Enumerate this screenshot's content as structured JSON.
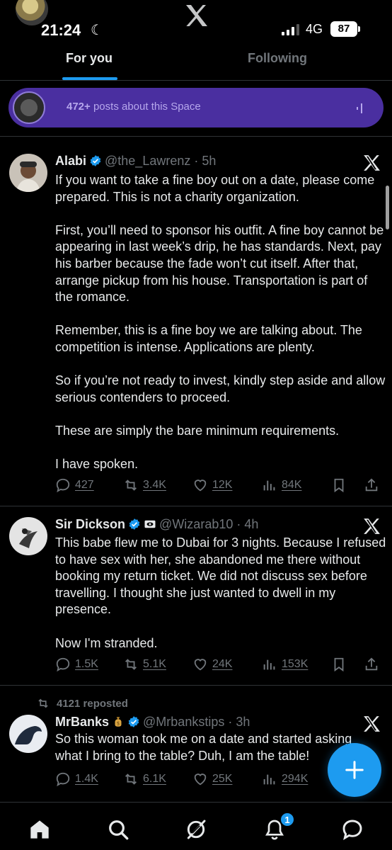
{
  "status_bar": {
    "time": "21:24",
    "network": "4G",
    "battery": "87"
  },
  "tabs": [
    {
      "label": "For you",
      "active": true
    },
    {
      "label": "Following",
      "active": false
    }
  ],
  "space_banner": {
    "count": "472+",
    "text": " posts about this Space"
  },
  "tweets": [
    {
      "name": "Alabi",
      "handle": "@the_Lawrenz",
      "time": "5h",
      "paragraphs": [
        "If you want to take a fine boy out on a date, please come prepared. This is not a charity organization.",
        "First, you’ll need to sponsor his outfit. A fine boy cannot be appearing in last week’s drip, he has standards. Next, pay his barber because the fade won’t cut itself. After that, arrange pickup from his house. Transportation is part of the romance.",
        "Remember, this is a fine boy we are talking about. The competition is intense. Applications are plenty.",
        "So if you’re not ready to invest, kindly step aside and allow serious contenders to proceed.",
        "These are simply the bare minimum requirements.",
        "I have spoken."
      ],
      "replies": "427",
      "reposts": "3.4K",
      "likes": "12K",
      "views": "84K"
    },
    {
      "name": "Sir Dickson",
      "handle": "@Wizarab10",
      "time": "4h",
      "paragraphs": [
        "This babe flew me to Dubai for 3 nights. Because I refused to have sex with her, she abandoned me there without booking my return ticket. We did not discuss sex before travelling. I thought she just wanted to dwell in my presence.",
        "Now I'm stranded."
      ],
      "replies": "1.5K",
      "reposts": "5.1K",
      "likes": "24K",
      "views": "153K"
    },
    {
      "reposted_by": "4121 reposted",
      "name": "MrBanks",
      "handle": "@Mrbankstips",
      "time": "3h",
      "paragraphs": [
        "So this woman took me on a date and started asking what I bring to the table? Duh, I am the table!"
      ],
      "replies": "1.4K",
      "reposts": "6.1K",
      "likes": "25K",
      "views": "294K"
    }
  ],
  "notifications_badge": "1",
  "colors": {
    "accent": "#1d9bf0",
    "background": "#000000",
    "muted": "#71767b",
    "space": "#4a2fa0"
  },
  "icons": [
    "x-logo",
    "verified-badge",
    "reply-icon",
    "repost-icon",
    "like-icon",
    "views-icon",
    "bookmark-icon",
    "share-icon",
    "home-icon",
    "search-icon",
    "grok-icon",
    "notifications-icon",
    "messages-icon",
    "compose-icon"
  ]
}
